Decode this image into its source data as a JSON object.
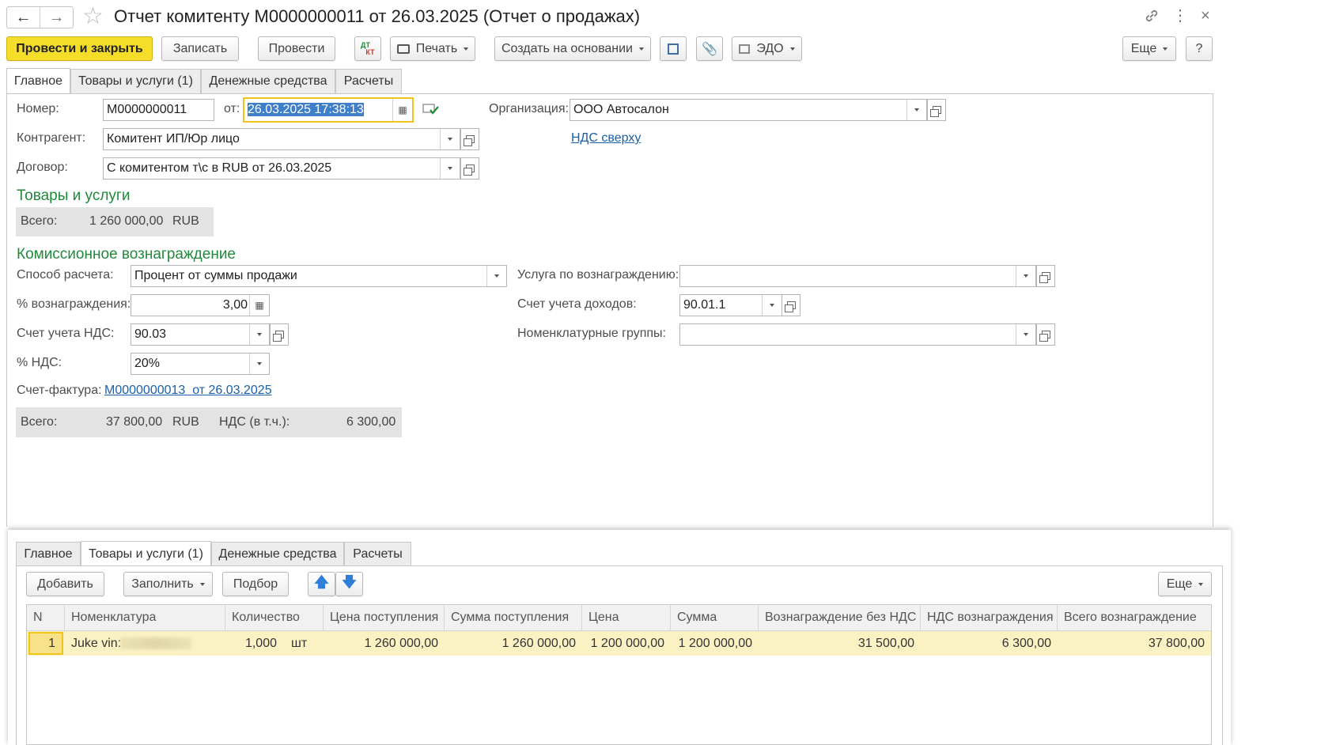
{
  "window": {
    "title": "Отчет комитенту М0000000011 от 26.03.2025 (Отчет о продажах)",
    "back_icon": "arrow-left-icon",
    "forward_icon": "arrow-right-icon"
  },
  "toolbar": {
    "post_close": "Провести и закрыть",
    "save": "Записать",
    "post": "Провести",
    "dtkt_top": "ДТ",
    "dtkt_bottom": "КТ",
    "print": "Печать",
    "create_based": "Создать на основании",
    "edo": "ЭДО",
    "more": "Еще",
    "help": "?"
  },
  "tabs": [
    "Главное",
    "Товары и услуги (1)",
    "Денежные средства",
    "Расчеты"
  ],
  "form": {
    "number_label": "Номер:",
    "number_value": "М0000000011",
    "from_label": "от:",
    "date_value": "26.03.2025 17:38:13",
    "org_label": "Организация:",
    "org_value": "ООО Автосалон",
    "counterparty_label": "Контрагент:",
    "counterparty_value": "Комитент ИП/Юр лицо",
    "vat_link": "НДС сверху",
    "contract_label": "Договор:",
    "contract_value": "С комитентом т\\с в RUB от 26.03.2025"
  },
  "goods_section": {
    "title": "Товары и услуги",
    "total_label": "Всего:",
    "total_value": "1 260 000,00",
    "currency": "RUB"
  },
  "commission": {
    "title": "Комиссионное вознаграждение",
    "method_label": "Способ расчета:",
    "method_value": "Процент от суммы продажи",
    "service_label": "Услуга по вознаграждению:",
    "service_value": "",
    "percent_label": "% вознаграждения:",
    "percent_value": "3,00",
    "income_label": "Счет учета доходов:",
    "income_value": "90.01.1",
    "vat_account_label": "Счет учета НДС:",
    "vat_account_value": "90.03",
    "nomenclature_groups_label": "Номенклатурные группы:",
    "nomenclature_groups_value": "",
    "vat_rate_label": "% НДС:",
    "vat_rate_value": "20%",
    "invoice_label": "Счет-фактура:",
    "invoice_link": "М0000000013  от 26.03.2025",
    "total_label": "Всего:",
    "total_value": "37 800,00",
    "currency": "RUB",
    "vat_incl_label": "НДС (в т.ч.):",
    "vat_incl_value": "6 300,00"
  },
  "lower": {
    "tabs": [
      "Главное",
      "Товары и услуги (1)",
      "Денежные средства",
      "Расчеты"
    ],
    "add": "Добавить",
    "fill": "Заполнить",
    "pick": "Подбор",
    "more": "Еще",
    "columns": [
      "N",
      "Номенклатура",
      "Количество",
      "Цена поступления",
      "Сумма поступления",
      "Цена",
      "Сумма",
      "Вознаграждение без НДС",
      "НДС вознаграждения",
      "Всего вознаграждение"
    ],
    "row": {
      "n": "1",
      "item": "Juke vin:",
      "qty": "1,000",
      "unit": "шт",
      "in_price": "1 260 000,00",
      "in_sum": "1 260 000,00",
      "price": "1 200 000,00",
      "sum": "1 200 000,00",
      "fee_no_vat": "31 500,00",
      "fee_vat": "6 300,00",
      "fee_total": "37 800,00"
    }
  },
  "colors": {
    "primary_button": "#f5dd2a",
    "section_title": "#1f8a3c",
    "link": "#1a5fa8",
    "date_focus": "#f0c419",
    "selected_row": "#fbf2c4"
  }
}
